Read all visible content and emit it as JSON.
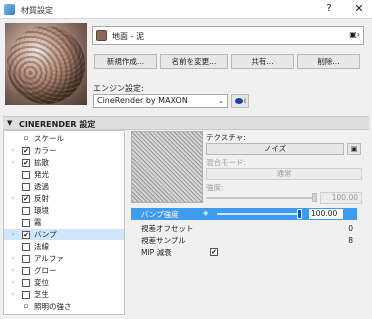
{
  "window": {
    "title": "材質設定",
    "help_glyph": "?",
    "close_glyph": "✕"
  },
  "material": {
    "name": "地面 - 泥",
    "swatch_color": "#8b6a59",
    "menu_glyph": "▣›"
  },
  "buttons": {
    "new": "新規作成...",
    "rename": "名前を変更...",
    "share": "共有...",
    "delete": "削除..."
  },
  "engine": {
    "label": "エンジン設定:",
    "value": "CineRender by MAXON",
    "chevron": "⌄",
    "info_glyph": "i"
  },
  "section": {
    "title": "CINERENDER 設定"
  },
  "channels": [
    {
      "label": "スケール",
      "checked": null,
      "expandable": false,
      "selected": false
    },
    {
      "label": "カラー",
      "checked": true,
      "expandable": true,
      "selected": false
    },
    {
      "label": "拡散",
      "checked": true,
      "expandable": true,
      "selected": false
    },
    {
      "label": "発光",
      "checked": false,
      "expandable": false,
      "selected": false
    },
    {
      "label": "透過",
      "checked": false,
      "expandable": false,
      "selected": false
    },
    {
      "label": "反射",
      "checked": true,
      "expandable": true,
      "selected": false
    },
    {
      "label": "環境",
      "checked": false,
      "expandable": false,
      "selected": false
    },
    {
      "label": "霧",
      "checked": false,
      "expandable": false,
      "selected": false
    },
    {
      "label": "バンプ",
      "checked": true,
      "expandable": true,
      "selected": true
    },
    {
      "label": "法線",
      "checked": false,
      "expandable": false,
      "selected": false
    },
    {
      "label": "アルファ",
      "checked": false,
      "expandable": true,
      "selected": false
    },
    {
      "label": "グロー",
      "checked": false,
      "expandable": true,
      "selected": false
    },
    {
      "label": "変位",
      "checked": false,
      "expandable": true,
      "selected": false
    },
    {
      "label": "芝生",
      "checked": false,
      "expandable": true,
      "selected": false
    },
    {
      "label": "照明の強さ",
      "checked": null,
      "expandable": false,
      "selected": false
    }
  ],
  "texture": {
    "label": "テクスチャ:",
    "value": "ノイズ",
    "menu_glyph": "▣"
  },
  "mix_mode": {
    "label": "混合モード:",
    "value": "通常"
  },
  "strength": {
    "label": "強度:",
    "value": "100.00",
    "level_percent": 100
  },
  "bump": {
    "label": "バンプ強度",
    "value": "100.00",
    "level_percent": 100,
    "icon": "◈"
  },
  "params": [
    {
      "label": "視差オフセット",
      "value": "0"
    },
    {
      "label": "視差サンプル",
      "value": "8"
    },
    {
      "label": "MIP 減衰",
      "value": "✔"
    }
  ]
}
